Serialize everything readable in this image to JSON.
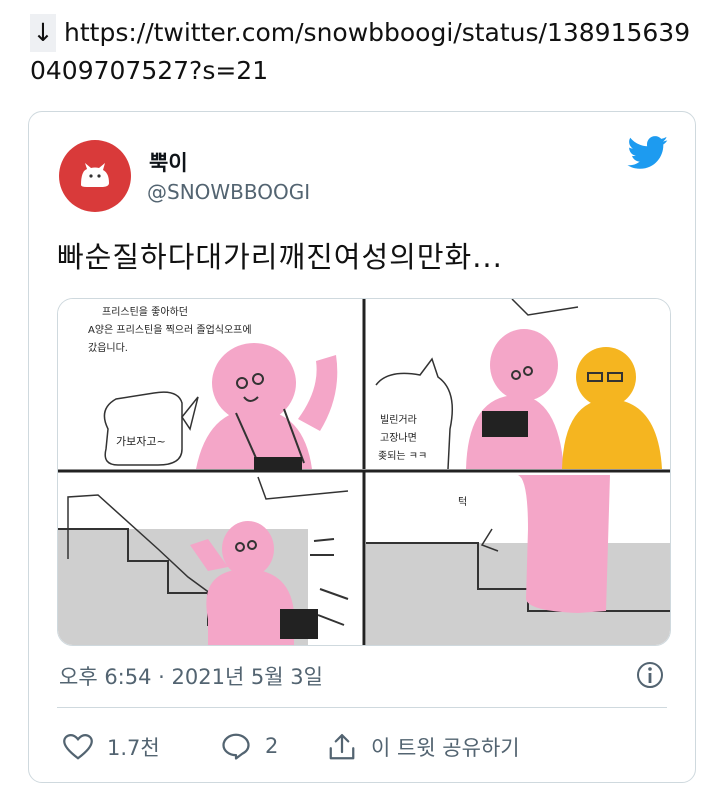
{
  "link": {
    "arrow_icon": "down-arrow-icon",
    "url": "https://twitter.com/snowbboogi/status/1389156390409707527?s=21"
  },
  "tweet": {
    "display_name": "뿍이",
    "handle": "@SNOWBBOOGI",
    "text": "빠순질하다대가리깨진여성의만화...",
    "timestamp": "오후 6:54 · 2021년 5월 3일",
    "brand_color": "#1d9bf0",
    "avatar_color": "#d93a3a"
  },
  "comic": {
    "panel1_caption_line1": "프리스틴을 좋아하던",
    "panel1_caption_line2": "A양은 프리스틴을 찍으러 졸업식오프에",
    "panel1_caption_line3": "갔읍니다.",
    "panel1_speech": "가보자고~",
    "panel2_speech_line1": "빌린거라",
    "panel2_speech_line2": "고장나면",
    "panel2_speech_line3": "좆되는 ㅋㅋ",
    "panel4_sfx": "턱"
  },
  "actions": {
    "like_count": "1.7천",
    "reply_count": "2",
    "share_label": "이 트윗 공유하기"
  }
}
